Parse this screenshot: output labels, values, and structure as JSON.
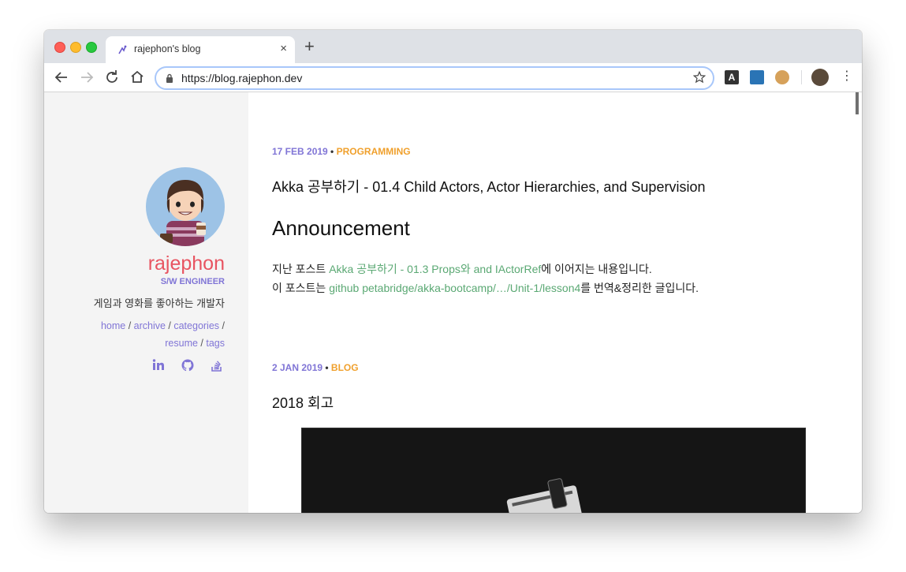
{
  "browser": {
    "tab_title": "rajephon's blog",
    "tab_close": "×",
    "new_tab": "+",
    "url": "https://blog.rajephon.dev",
    "extension_a_label": "A",
    "menu_glyph": "⋮"
  },
  "sidebar": {
    "name": "rajephon",
    "role": "S/W ENGINEER",
    "description": "게임과 영화를 좋아하는 개발자",
    "nav": {
      "home": "home",
      "archive": "archive",
      "categories": "categories",
      "resume": "resume",
      "tags": "tags",
      "separator": " / "
    },
    "social_icons": [
      "linkedin-icon",
      "github-icon",
      "stackoverflow-icon"
    ]
  },
  "posts": [
    {
      "date": "17 FEB 2019",
      "bullet": " • ",
      "category": "PROGRAMMING",
      "title": "Akka 공부하기 - 01.4 Child Actors, Actor Hierarchies, and Supervision",
      "heading": "Announcement",
      "line1_prefix": "지난 포스트 ",
      "line1_link": "Akka 공부하기 - 01.3 Props와 and IActorRef",
      "line1_suffix": "에 이어지는 내용입니다.",
      "line2_prefix": "이 포스트는 ",
      "line2_link": "github petabridge/akka-bootcamp/…/Unit-1/lesson4",
      "line2_suffix": "를 번역&정리한 글입니다."
    },
    {
      "date": "2 JAN 2019",
      "bullet": " • ",
      "category": "BLOG",
      "title": "2018 회고"
    }
  ],
  "colors": {
    "accent_purple": "#8075d6",
    "brand_red": "#e85461",
    "category_orange": "#f0a02c",
    "link_green": "#5aa873",
    "sidebar_bg": "#f4f4f4"
  }
}
